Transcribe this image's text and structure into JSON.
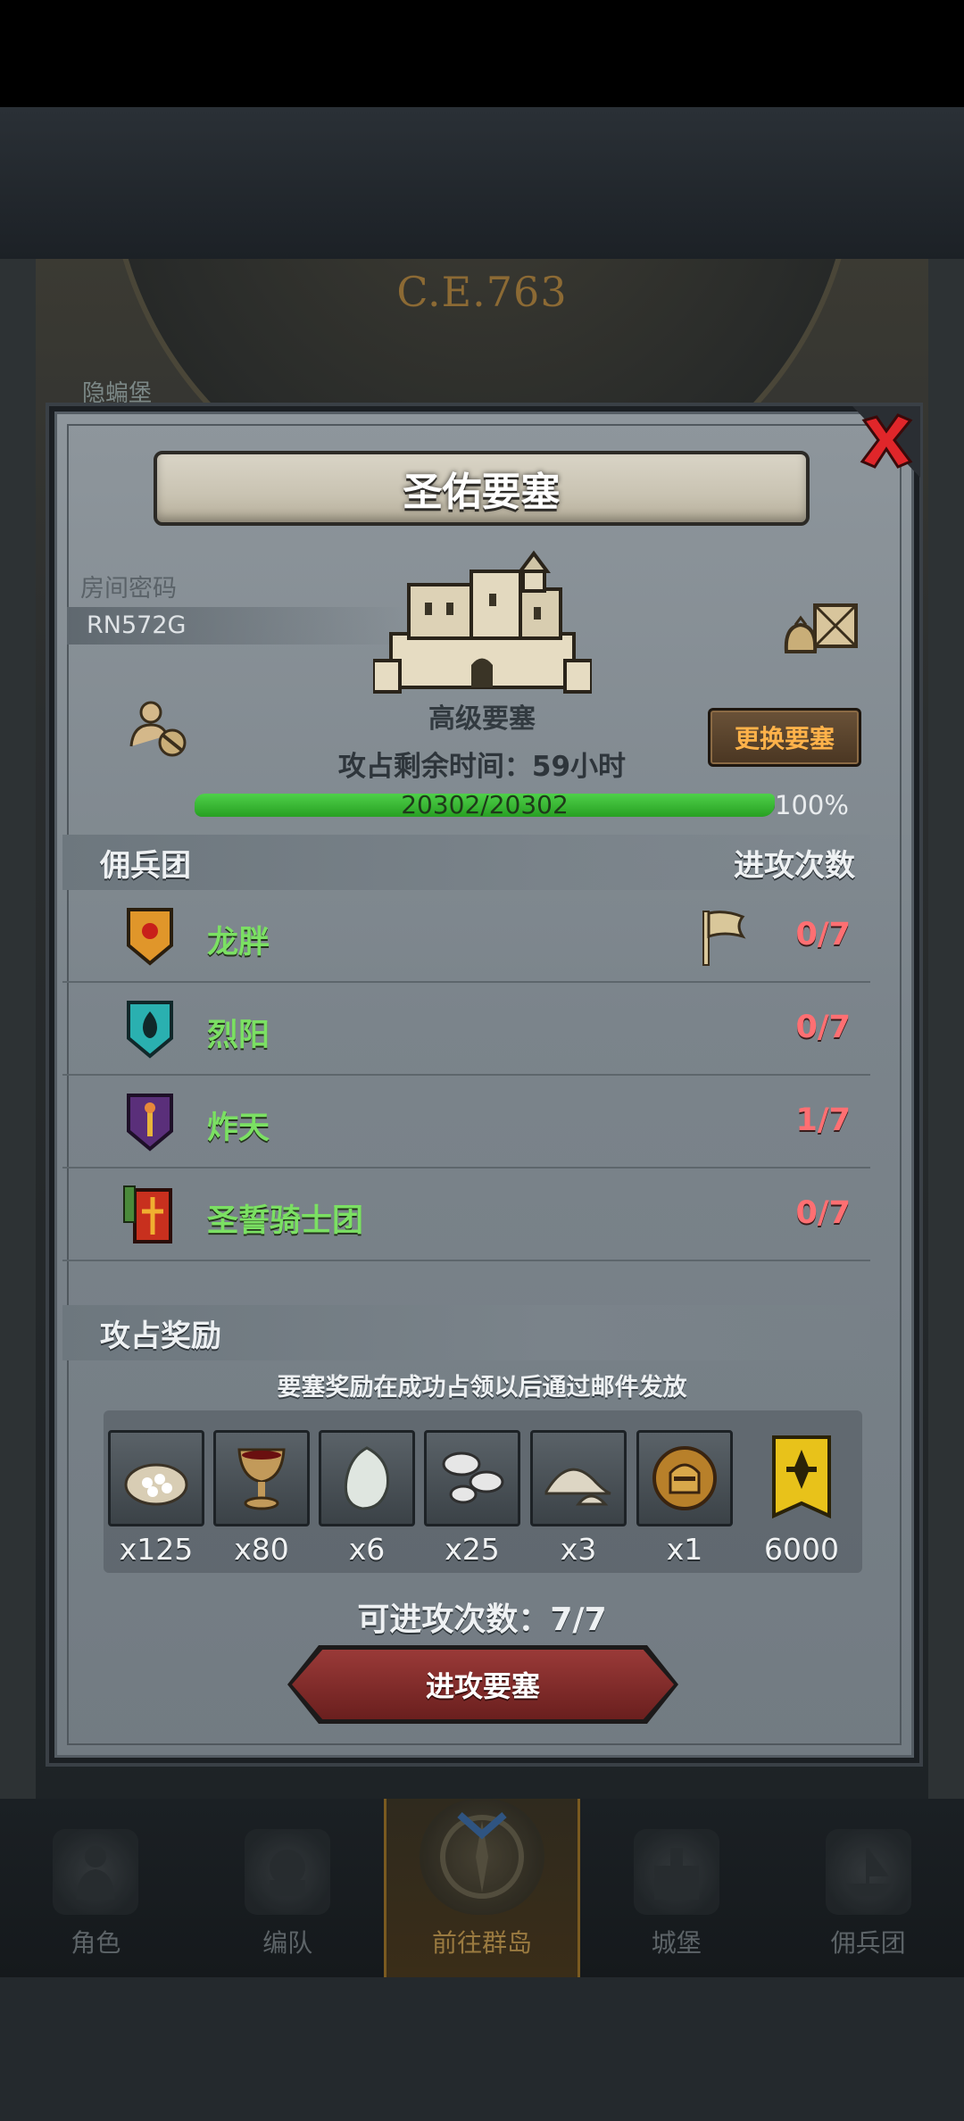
{
  "background": {
    "year": "C.E.763",
    "castle_label": "隐蝙堡"
  },
  "modal": {
    "title": "圣佑要塞",
    "room_label": "房间密码",
    "room_code": "RN572G",
    "fortress_type": "高级要塞",
    "change_button": "更换要塞",
    "remaining_time": "攻占剩余时间：59小时",
    "progress_text": "20302/20302",
    "progress_percent": "100%",
    "progress_fraction": 1.0,
    "mercenary_header": "佣兵团",
    "attack_count_header": "进攻次数",
    "mercenaries": [
      {
        "name": "龙胖",
        "count": "0/7",
        "emblem": "sun-shield-icon",
        "flag": true
      },
      {
        "name": "烈阳",
        "count": "0/7",
        "emblem": "flame-shield-icon",
        "flag": false
      },
      {
        "name": "炸天",
        "count": "1/7",
        "emblem": "torch-shield-icon",
        "flag": false
      },
      {
        "name": "圣誓骑士团",
        "count": "0/7",
        "emblem": "knight-banner-icon",
        "flag": false
      }
    ],
    "reward_header": "攻占奖励",
    "reward_note": "要塞奖励在成功占领以后通过邮件发放",
    "rewards": [
      {
        "icon": "salt-sack-icon",
        "qty": "x125"
      },
      {
        "icon": "goblet-icon",
        "qty": "x80"
      },
      {
        "icon": "pearl-icon",
        "qty": "x6"
      },
      {
        "icon": "mushroom-icon",
        "qty": "x25"
      },
      {
        "icon": "powder-pile-icon",
        "qty": "x3"
      },
      {
        "icon": "knight-helmet-icon",
        "qty": "x1"
      },
      {
        "icon": "guild-banner-icon",
        "qty": "6000"
      }
    ],
    "available_attacks": "可进攻次数：7/7",
    "attack_button": "进攻要塞"
  },
  "bottom_nav": [
    {
      "label": "角色",
      "icon": "character-icon"
    },
    {
      "label": "编队",
      "icon": "formation-icon"
    },
    {
      "label": "前往群岛",
      "icon": "islands-compass-icon",
      "active": true
    },
    {
      "label": "城堡",
      "icon": "castle-icon"
    },
    {
      "label": "佣兵团",
      "icon": "mercenary-ship-icon"
    }
  ],
  "colors": {
    "accent_green": "#7be063",
    "count_red": "#ff6f72",
    "button_orange": "#ffb24a",
    "attack_button": "#8a2e2c"
  }
}
